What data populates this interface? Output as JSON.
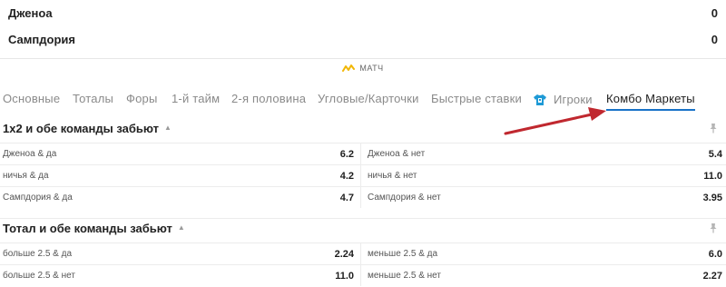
{
  "match": {
    "team1": {
      "name": "Дженоа",
      "score": "0"
    },
    "team2": {
      "name": "Сампдория",
      "score": "0"
    },
    "label": "МАТЧ"
  },
  "tabs": [
    {
      "label": "Основные",
      "active": false
    },
    {
      "label": "Тоталы",
      "active": false
    },
    {
      "label": "Форы",
      "active": false
    },
    {
      "label": "1-й тайм",
      "active": false
    },
    {
      "label": "2-я половина",
      "active": false
    },
    {
      "label": "Угловые/Карточки",
      "active": false
    },
    {
      "label": "Быстрые ставки",
      "active": false
    },
    {
      "label": "Игроки",
      "active": false,
      "icon": "shirt-icon"
    },
    {
      "label": "Комбо Маркеты",
      "active": true
    }
  ],
  "sections": [
    {
      "title": "1x2 и обе команды забьют",
      "rows": [
        {
          "left": {
            "label": "Дженоа & да",
            "odd": "6.2"
          },
          "right": {
            "label": "Дженоа & нет",
            "odd": "5.4"
          }
        },
        {
          "left": {
            "label": "ничья & да",
            "odd": "4.2"
          },
          "right": {
            "label": "ничья & нет",
            "odd": "11.0"
          }
        },
        {
          "left": {
            "label": "Сампдория & да",
            "odd": "4.7"
          },
          "right": {
            "label": "Сампдория & нет",
            "odd": "3.95"
          }
        }
      ]
    },
    {
      "title": "Тотал и обе команды забьют",
      "rows": [
        {
          "left": {
            "label": "больше 2.5 & да",
            "odd": "2.24"
          },
          "right": {
            "label": "меньше 2.5 & да",
            "odd": "6.0"
          }
        },
        {
          "left": {
            "label": "больше 2.5 & нет",
            "odd": "11.0"
          },
          "right": {
            "label": "меньше 2.5 & нет",
            "odd": "2.27"
          }
        }
      ]
    }
  ],
  "colors": {
    "accent": "#1872c8",
    "annotation_arrow": "#c0282f",
    "match_icon": "#f2b705"
  }
}
